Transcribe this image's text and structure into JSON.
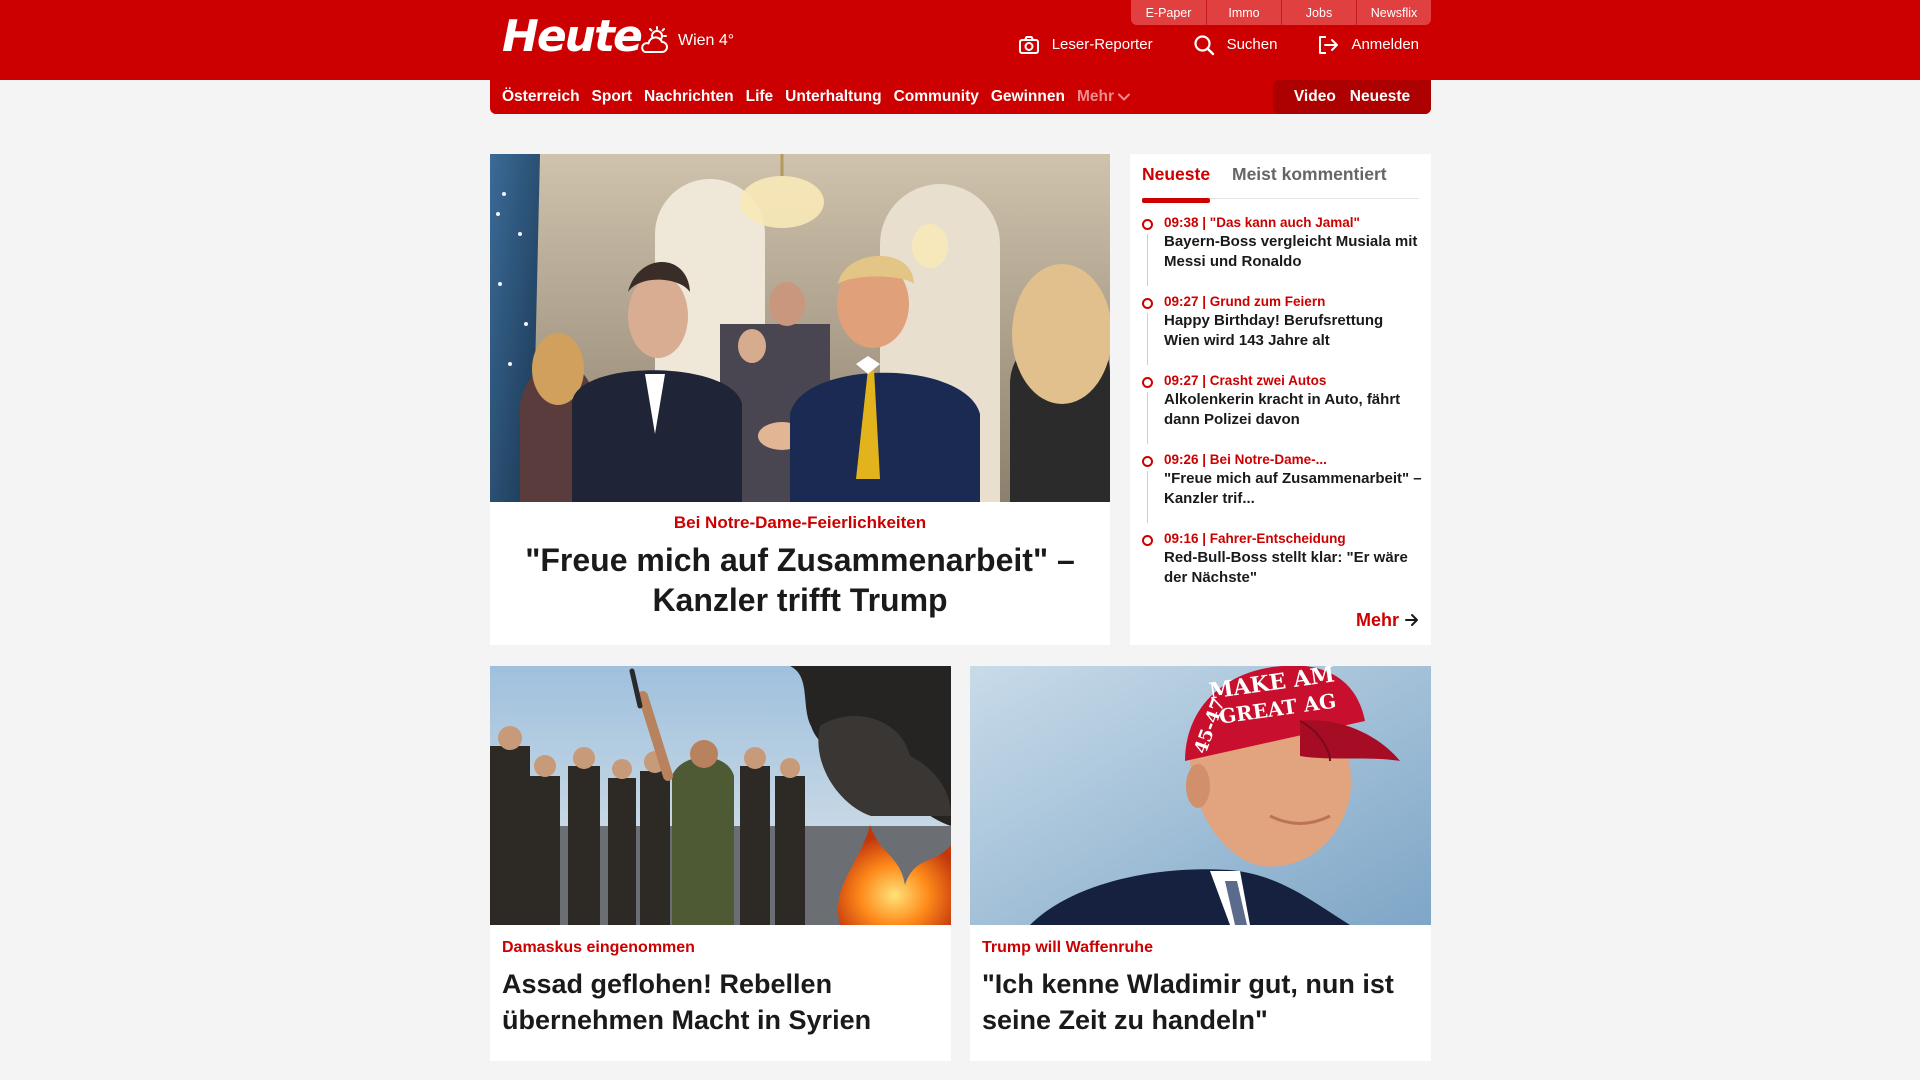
{
  "header": {
    "logo": "Heute",
    "weather": "Wien 4°",
    "util_tabs": [
      "E-Paper",
      "Immo",
      "Jobs",
      "Newsflix"
    ],
    "actions": {
      "reporter": "Leser-Reporter",
      "search": "Suchen",
      "login": "Anmelden"
    }
  },
  "nav": {
    "items": [
      "Österreich",
      "Sport",
      "Nachrichten",
      "Life",
      "Unterhaltung",
      "Community",
      "Gewinnen"
    ],
    "more": "Mehr",
    "video": "Video",
    "latest": "Neueste"
  },
  "hero": {
    "kicker": "Bei Notre-Dame-Feierlichkeiten",
    "title": "\"Freue mich auf Zusammenarbeit\" – Kanzler trifft Trump"
  },
  "sidebar": {
    "tab_active": "Neueste",
    "tab_inactive": "Meist kommentiert",
    "items": [
      {
        "meta": "09:38 | \"Das kann auch Jamal\"",
        "title": "Bayern-Boss vergleicht Musiala mit Messi und Ronaldo"
      },
      {
        "meta": "09:27 | Grund zum Feiern",
        "title": "Happy Birthday! Berufsrettung Wien wird 143 Jahre alt"
      },
      {
        "meta": "09:27 | Crasht zwei Autos",
        "title": "Alkolenkerin kracht in Auto, fährt dann Polizei davon"
      },
      {
        "meta": "09:26 | Bei Notre-Dame-...",
        "title": "\"Freue mich auf Zusammenarbeit\" – Kanzler trif..."
      },
      {
        "meta": "09:16 | Fahrer-Entscheidung",
        "title": "Red-Bull-Boss stellt klar: \"Er wäre der Nächste\""
      }
    ],
    "more": "Mehr"
  },
  "cards": [
    {
      "kicker": "Damaskus eingenommen",
      "title": "Assad geflohen! Rebellen übernehmen Macht in Syrien"
    },
    {
      "kicker": "Trump will Waffenruhe",
      "title": "\"Ich kenne Wladimir gut, nun ist seine Zeit zu handeln\""
    }
  ],
  "colors": {
    "brand": "#cc0000",
    "brand_dark": "#ad0000",
    "background": "#f4f4f4"
  },
  "icons": {
    "weather": "cloud-sun-icon",
    "reporter": "camera-icon",
    "search": "search-icon",
    "login": "login-icon",
    "more": "chevron-down-icon",
    "arrow": "arrow-right-icon"
  }
}
